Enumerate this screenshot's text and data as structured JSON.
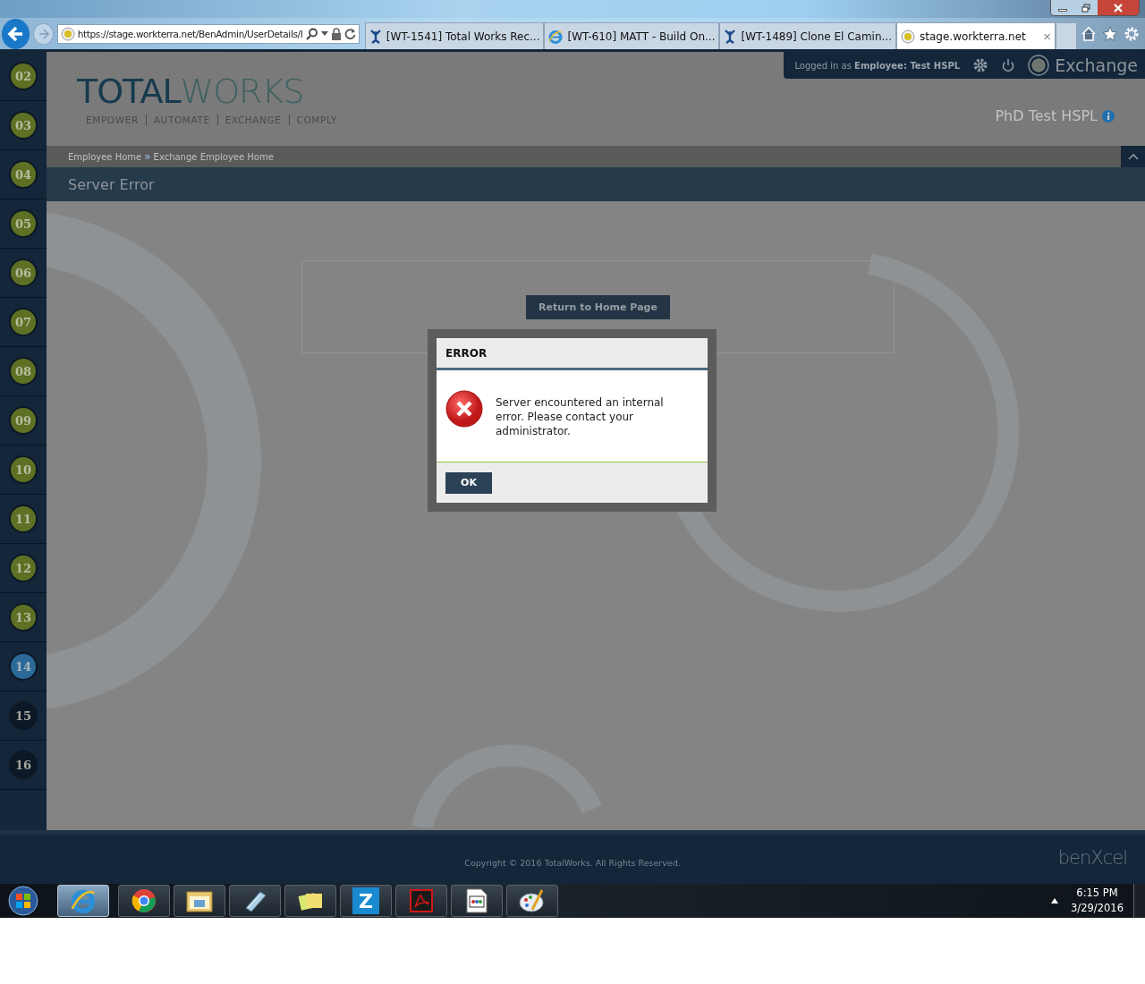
{
  "browser": {
    "back_button": {
      "disabled": false
    },
    "forward_button": {
      "disabled": true
    },
    "address": "https://stage.workterra.net/BenAdmin/UserDetails/I",
    "tabs": [
      {
        "kind": "jira",
        "label": "[WT-1541] Total Works Rec...",
        "selected": false
      },
      {
        "kind": "ie",
        "label": "[WT-610] MATT - Build On...",
        "selected": false
      },
      {
        "kind": "jira",
        "label": "[WT-1489] Clone El Camin...",
        "selected": false
      },
      {
        "kind": "site",
        "label": "stage.workterra.net",
        "selected": true
      }
    ],
    "close_tab": "×"
  },
  "steps": [
    {
      "number": "02",
      "kind": "done"
    },
    {
      "number": "03",
      "kind": "done"
    },
    {
      "number": "04",
      "kind": "done"
    },
    {
      "number": "05",
      "kind": "done"
    },
    {
      "number": "06",
      "kind": "done"
    },
    {
      "number": "07",
      "kind": "done"
    },
    {
      "number": "08",
      "kind": "done"
    },
    {
      "number": "09",
      "kind": "done"
    },
    {
      "number": "10",
      "kind": "done"
    },
    {
      "number": "11",
      "kind": "done"
    },
    {
      "number": "12",
      "kind": "done"
    },
    {
      "number": "13",
      "kind": "done"
    },
    {
      "number": "14",
      "kind": "current"
    },
    {
      "number": "15",
      "kind": "todo"
    },
    {
      "number": "16",
      "kind": "todo"
    }
  ],
  "header": {
    "logo": [
      "TOTAL",
      "WORKS"
    ],
    "tagline": [
      "EMPOWER",
      "AUTOMATE",
      "EXCHANGE",
      "COMPLY"
    ],
    "login": "Logged in as **Employee:  Test HSPL**",
    "portal": "Exchange",
    "company": "PhD Test HSPL"
  },
  "breadcrumbs": {
    "items": [
      "Employee Home",
      "Exchange Employee Home"
    ],
    "separator": "»"
  },
  "page_title": "Server Error",
  "return_button": "Return to Home Page",
  "dialog": {
    "title": "ERROR",
    "message": "Server encountered an internal error. Please contact your administrator.",
    "ok_button": "OK"
  },
  "footer": {
    "copyright": "Copyright © 2016 TotalWorks. All Rights Reserved.",
    "brand": "benXcel"
  },
  "taskbar": {
    "apps": [
      {
        "kind": "ie",
        "selected": true
      },
      {
        "kind": "chrome",
        "selected": false
      },
      {
        "kind": "explorer",
        "selected": false
      },
      {
        "kind": "notepad",
        "selected": false
      },
      {
        "kind": "notes",
        "selected": false
      },
      {
        "kind": "letter",
        "label": "Z",
        "selected": false
      },
      {
        "kind": "acrobat",
        "selected": false
      },
      {
        "kind": "document",
        "selected": false
      },
      {
        "kind": "paint",
        "selected": false
      }
    ],
    "time": "6:15 PM",
    "date": "3/29/2016"
  }
}
